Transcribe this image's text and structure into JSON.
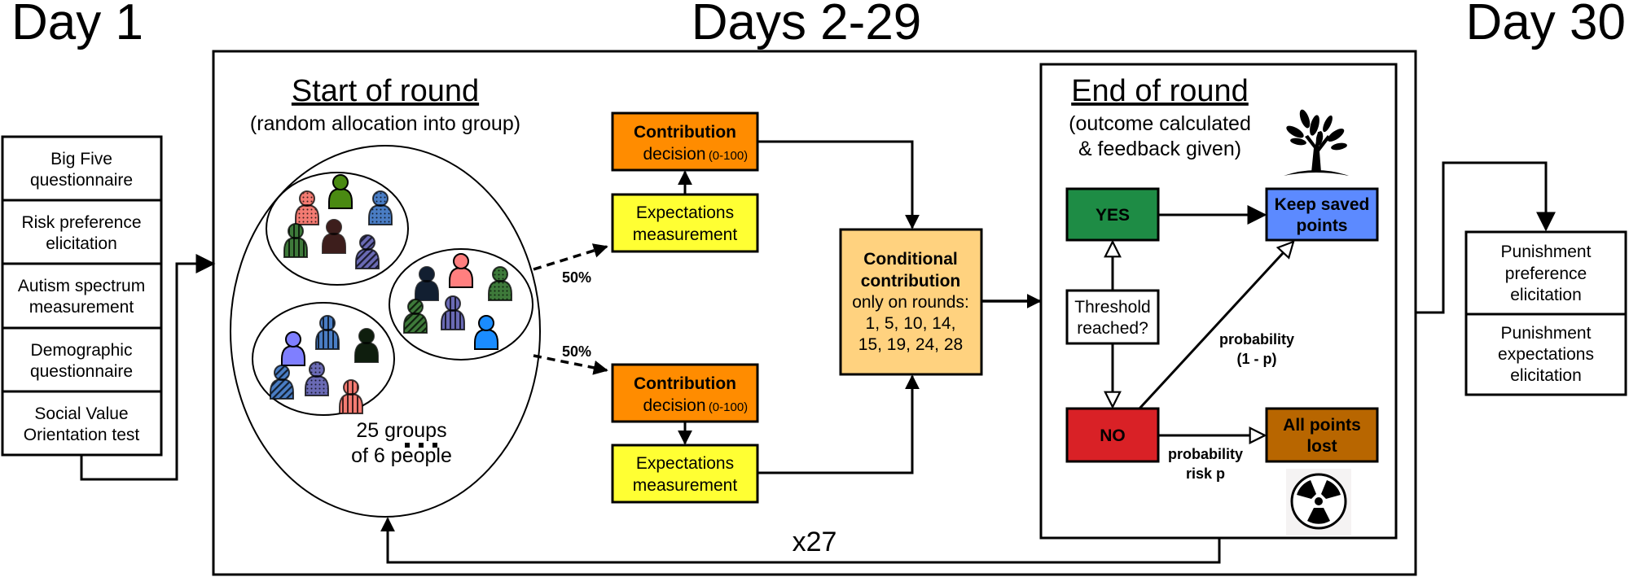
{
  "headers": {
    "day1": "Day 1",
    "days_mid": "Days 2-29",
    "day30": "Day 30"
  },
  "day1_tasks": [
    {
      "line1": "Big Five",
      "line2": "questionnaire"
    },
    {
      "line1": "Risk preference",
      "line2": "elicitation"
    },
    {
      "line1": "Autism spectrum",
      "line2": "measurement"
    },
    {
      "line1": "Demographic",
      "line2": "questionnaire"
    },
    {
      "line1": "Social Value",
      "line2": "Orientation test"
    }
  ],
  "start_of_round": {
    "title": "Start of round",
    "subtitle": "(random allocation into group)",
    "groups_line1": "25 groups",
    "groups_line2": "of 6 people",
    "ellipsis": "...",
    "groups": [
      {
        "members": [
          {
            "color": "#f47b72",
            "pattern": "dots"
          },
          {
            "color": "#4a8a12",
            "pattern": "solid"
          },
          {
            "color": "#4a7dc4",
            "pattern": "dots"
          },
          {
            "color": "#3e7a3a",
            "pattern": "vstripes"
          },
          {
            "color": "#f47b72",
            "pattern": "grid"
          },
          {
            "color": "#6a6ab4",
            "pattern": "dstripes"
          }
        ]
      },
      {
        "members": [
          {
            "color": "#4a7dc4",
            "pattern": "grid"
          },
          {
            "color": "#ff7f7f",
            "pattern": "solid"
          },
          {
            "color": "#3e7a3a",
            "pattern": "dots"
          },
          {
            "color": "#3e7a3a",
            "pattern": "dstripes"
          },
          {
            "color": "#6a6ab4",
            "pattern": "vstripes"
          },
          {
            "color": "#1a8cff",
            "pattern": "solid"
          }
        ]
      },
      {
        "members": [
          {
            "color": "#7f7fff",
            "pattern": "solid"
          },
          {
            "color": "#4a7dc4",
            "pattern": "vstripes"
          },
          {
            "color": "#3e7a3a",
            "pattern": "grid"
          },
          {
            "color": "#4a7dc4",
            "pattern": "dstripes"
          },
          {
            "color": "#6a6ab4",
            "pattern": "dots"
          },
          {
            "color": "#f47b72",
            "pattern": "vstripes"
          }
        ]
      }
    ]
  },
  "branches": {
    "top_pct": "50%",
    "bottom_pct": "50%"
  },
  "contribution": {
    "title": "Contribution",
    "line2": "decision",
    "range": "(0-100)",
    "color": "#ff8c00"
  },
  "expectations": {
    "line1": "Expectations",
    "line2": "measurement",
    "color": "#ffff33"
  },
  "conditional": {
    "line1": "Conditional",
    "line2": "contribution",
    "line3": "only on rounds:",
    "line4": "1, 5, 10, 14,",
    "line5": "15, 19, 24, 28",
    "color": "#ffd27f"
  },
  "end_of_round": {
    "title": "End of round",
    "subtitle1": "(outcome calculated",
    "subtitle2": "& feedback given)",
    "yes": {
      "label": "YES",
      "color": "#1e8c45"
    },
    "no": {
      "label": "NO",
      "color": "#d92126"
    },
    "threshold": {
      "line1": "Threshold",
      "line2": "reached?"
    },
    "keep": {
      "line1": "Keep saved",
      "line2": "points",
      "color": "#5c8aff"
    },
    "lost": {
      "line1": "All points",
      "line2": "lost",
      "color": "#b86600"
    },
    "prob_keep_1": "probability",
    "prob_keep_2": "(1 - p)",
    "prob_lost_1": "probability",
    "prob_lost_2": "risk p"
  },
  "repeat": "x27",
  "day30_tasks": [
    {
      "line1": "Punishment",
      "line2": "preference",
      "line3": "elicitation"
    },
    {
      "line1": "Punishment",
      "line2": "expectations",
      "line3": "elicitation"
    }
  ],
  "icons": {
    "tree": "tree-icon",
    "radiation": "radiation-icon"
  }
}
